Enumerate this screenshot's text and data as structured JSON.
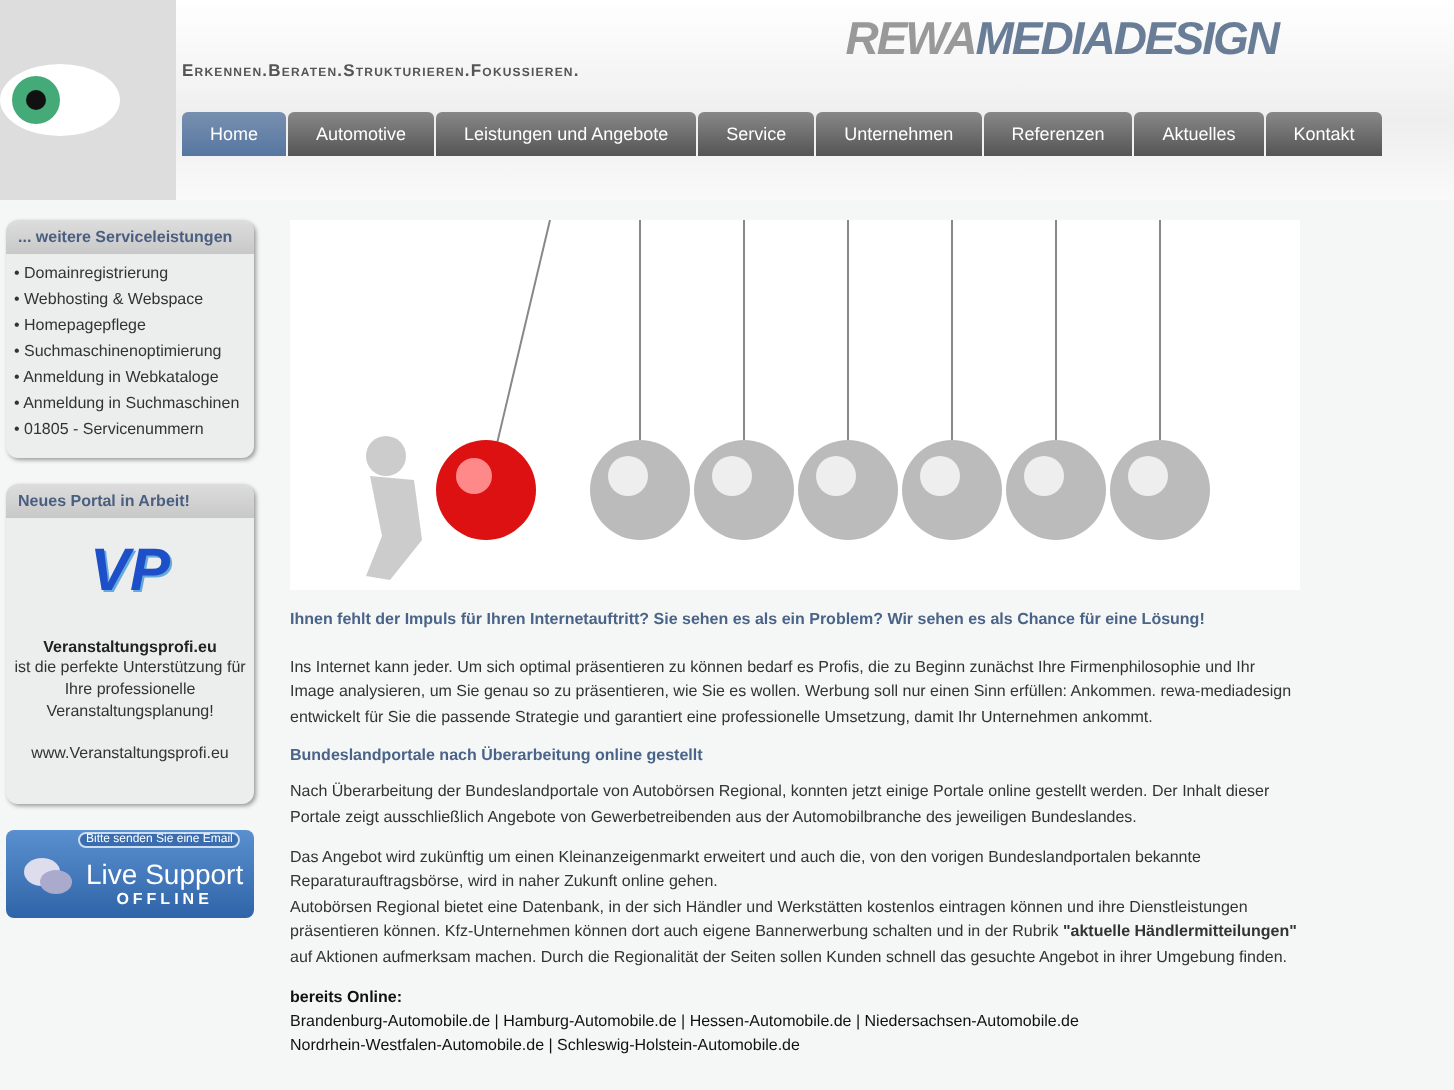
{
  "header": {
    "logo_left": "REWA",
    "logo_right": "MEDIADESIGN",
    "tagline": "Erkennen.Beraten.Strukturieren.Fokussieren."
  },
  "nav": [
    {
      "label": "Home",
      "selected": true
    },
    {
      "label": "Automotive",
      "selected": false
    },
    {
      "label": "Leistungen und Angebote",
      "selected": false
    },
    {
      "label": "Service",
      "selected": false
    },
    {
      "label": "Unternehmen",
      "selected": false
    },
    {
      "label": "Referenzen",
      "selected": false
    },
    {
      "label": "Aktuelles",
      "selected": false
    },
    {
      "label": "Kontakt",
      "selected": false
    }
  ],
  "sidebar": {
    "services": {
      "title": "... weitere Serviceleistungen",
      "items": [
        "• Domainregistrierung",
        "• Webhosting & Webspace",
        "• Homepagepflege",
        "• Suchmaschinenoptimierung",
        "• Anmeldung in Webkataloge",
        "• Anmeldung in Suchmaschinen",
        "• 01805 - Servicenummern"
      ]
    },
    "portal": {
      "title": "Neues Portal in Arbeit!",
      "logo_text": "VP",
      "name": "Veranstaltungsprofi.eu",
      "description": "ist die perfekte Unterstützung für Ihre professionelle Veranstaltungsplanung!",
      "url": "www.Veranstaltungsprofi.eu"
    },
    "live_support": {
      "tag": "Bitte senden Sie eine Email",
      "title": "Live Support",
      "status": "OFFLINE"
    }
  },
  "main": {
    "headline": "Ihnen fehlt der Impuls für Ihren Internetauftritt? Sie sehen es als ein Problem? Wir sehen es als Chance für eine Lösung!",
    "intro": "Ins Internet kann jeder. Um sich optimal präsentieren zu können bedarf es Profis, die zu Beginn zunächst Ihre Firmenphilosophie und Ihr Image analysieren, um Sie genau so zu präsentieren, wie Sie es wollen. Werbung soll nur einen Sinn erfüllen: Ankommen. rewa-mediadesign entwickelt für Sie die passende Strategie und garantiert eine professionelle Umsetzung, damit Ihr Unternehmen ankommt.",
    "subheading": "Bundeslandportale nach Überarbeitung online gestellt",
    "paragraphs": [
      "Nach Überarbeitung der Bundeslandportale von Autobörsen Regional, konnten jetzt einige Portale online gestellt werden. Der Inhalt dieser Portale zeigt ausschließlich Angebote von Gewerbetreibenden aus der Automobilbranche des jeweiligen Bundeslandes.",
      "Das Angebot wird zukünftig um einen Kleinanzeigenmarkt erweitert und auch die, von den vorigen Bundeslandportalen bekannte Reparaturauftragsbörse, wird in naher Zukunft online gehen.\nAutobörsen Regional bietet eine Datenbank, in der sich Händler und Werkstätten kostenlos eintragen können und ihre Dienstleistungen präsentieren können. Kfz-Unternehmen können dort auch eigene Bannerwerbung schalten und in der Rubrik **\"aktuelle Händlermitteilungen\"** auf Aktionen aufmerksam machen. Durch die Regionalität der Seiten sollen Kunden schnell das gesuchte Angebot in ihrer Umgebung finden."
    ],
    "online_label": "bereits Online:",
    "online_lines": [
      "Brandenburg-Automobile.de | Hamburg-Automobile.de | Hessen-Automobile.de | Niedersachsen-Automobile.de",
      "Nordrhein-Westfalen-Automobile.de | Schleswig-Holstein-Automobile.de"
    ]
  }
}
